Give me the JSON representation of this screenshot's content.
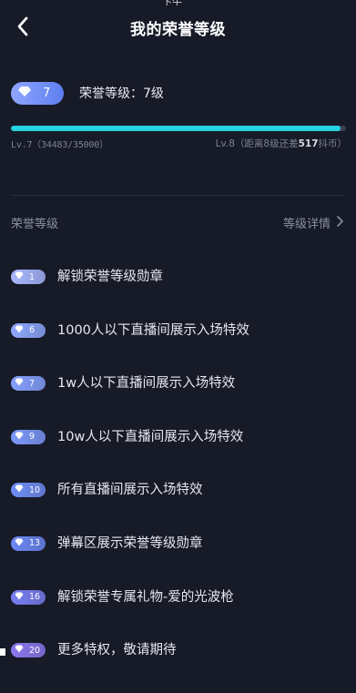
{
  "status_bar": {
    "fragment": "下午"
  },
  "nav": {
    "title": "我的荣誉等级"
  },
  "current_level": {
    "badge_number": "7",
    "label": "荣誉等级：7级"
  },
  "progress": {
    "fraction": 0.985,
    "left_text": "Lv.7（34483/35000）",
    "right_prefix": "Lv.8（距离8级还差",
    "right_amount": "517",
    "right_suffix": "抖币）"
  },
  "section": {
    "title": "荣誉等级",
    "detail_link": "等级详情"
  },
  "privileges": [
    {
      "level": "1",
      "text": "解锁荣誉等级勋章",
      "badge_color": "#a9b8ff"
    },
    {
      "level": "6",
      "text": "1000人以下直播间展示入场特效",
      "badge_color": "#8ea8ff"
    },
    {
      "level": "7",
      "text": "1w人以下直播间展示入场特效",
      "badge_color": "#86a1ff"
    },
    {
      "level": "9",
      "text": "10w人以下直播间展示入场特效",
      "badge_color": "#7d99fb"
    },
    {
      "level": "10",
      "text": "所有直播间展示入场特效",
      "badge_color": "#6f8ef7"
    },
    {
      "level": "13",
      "text": "弹幕区展示荣誉等级勋章",
      "badge_color": "#6c88f5"
    },
    {
      "level": "16",
      "text": "解锁荣誉专属礼物-爱的光波枪",
      "badge_color": "#7a7ef2"
    },
    {
      "level": "20",
      "text": "更多特权，敬请期待",
      "badge_color": "#8c78ef"
    }
  ],
  "icons": {
    "back": "chevron-left-icon",
    "detail": "chevron-right-icon",
    "badge": "diamond-icon"
  },
  "colors": {
    "background": "#171a27",
    "progress_fill": "#27d2e3",
    "progress_track": "#3a3e4d"
  }
}
